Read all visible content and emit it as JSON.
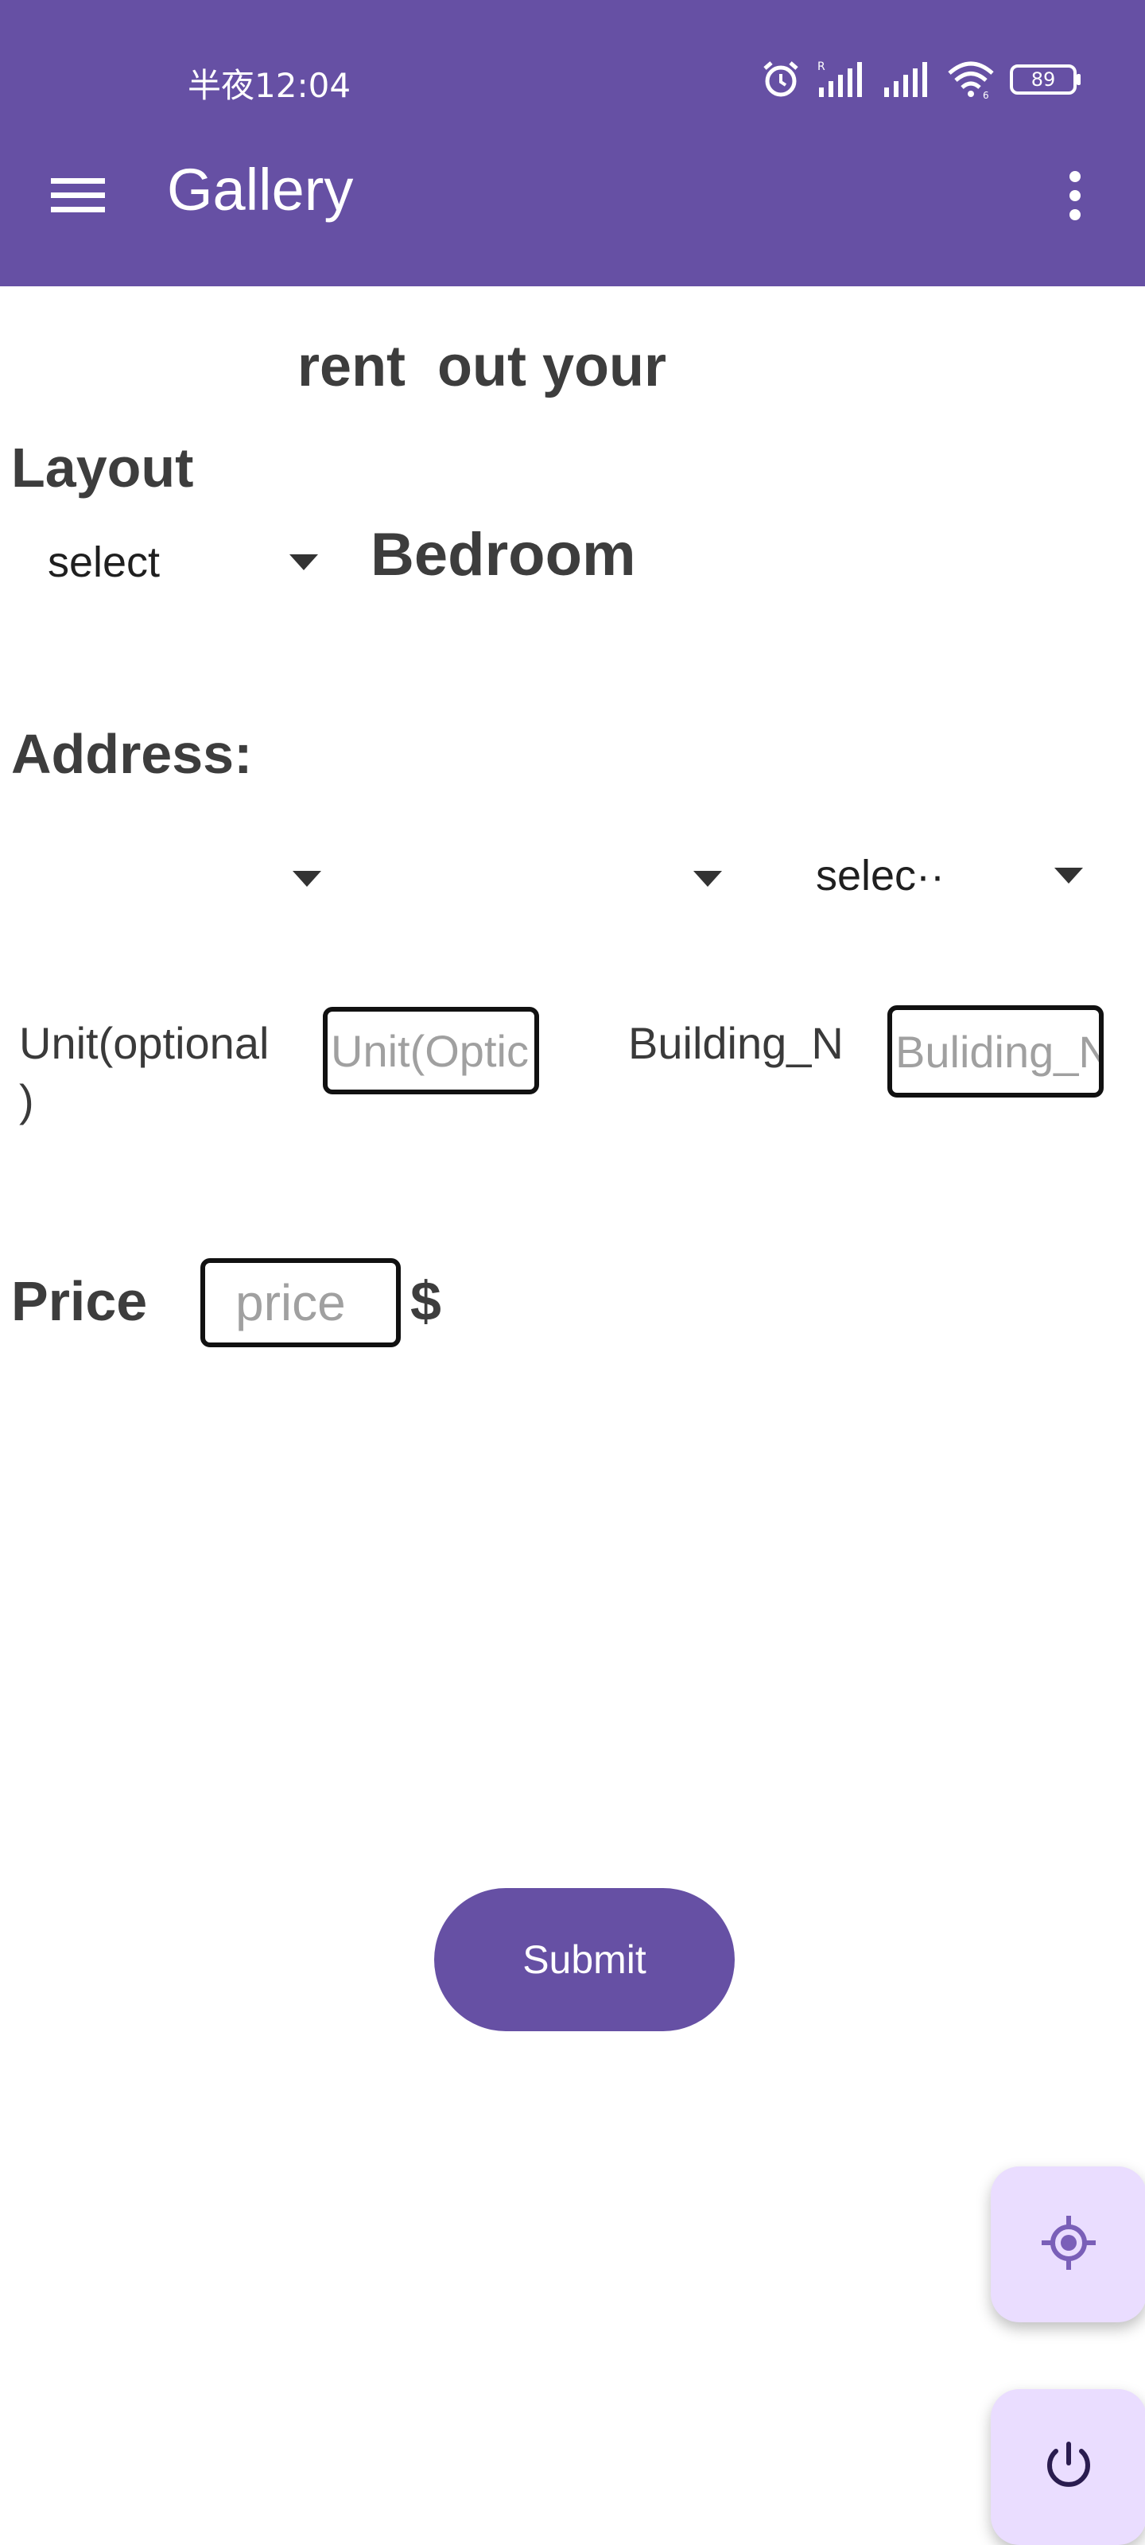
{
  "status_bar": {
    "time": "半夜12:04",
    "battery": "89",
    "icons": [
      "alarm-icon",
      "signal-icon",
      "signal-icon",
      "wifi-icon",
      "battery-icon"
    ]
  },
  "app_bar": {
    "title": "Gallery",
    "icons": [
      "menu-icon",
      "more-vert-icon"
    ],
    "color": "#6650a4"
  },
  "form": {
    "heading": "rent  out your",
    "layout_label": "Layout",
    "layout_select_value": "select",
    "bedroom_label": "Bedroom",
    "address_label": "Address:",
    "address_select_1_value": "",
    "address_select_2_value": "",
    "address_select_3_value": "selec··",
    "unit_label_line1": "Unit(optional",
    "unit_label_line2": ")",
    "unit_placeholder": "Unit(Optic",
    "building_label": "Building_N",
    "building_placeholder": "Buliding_N",
    "price_label": "Price",
    "price_placeholder": "price",
    "currency": "$",
    "submit_label": "Submit"
  },
  "fabs": {
    "icons": [
      "gps-locate-icon",
      "power-icon"
    ],
    "color": "#eaddff"
  }
}
